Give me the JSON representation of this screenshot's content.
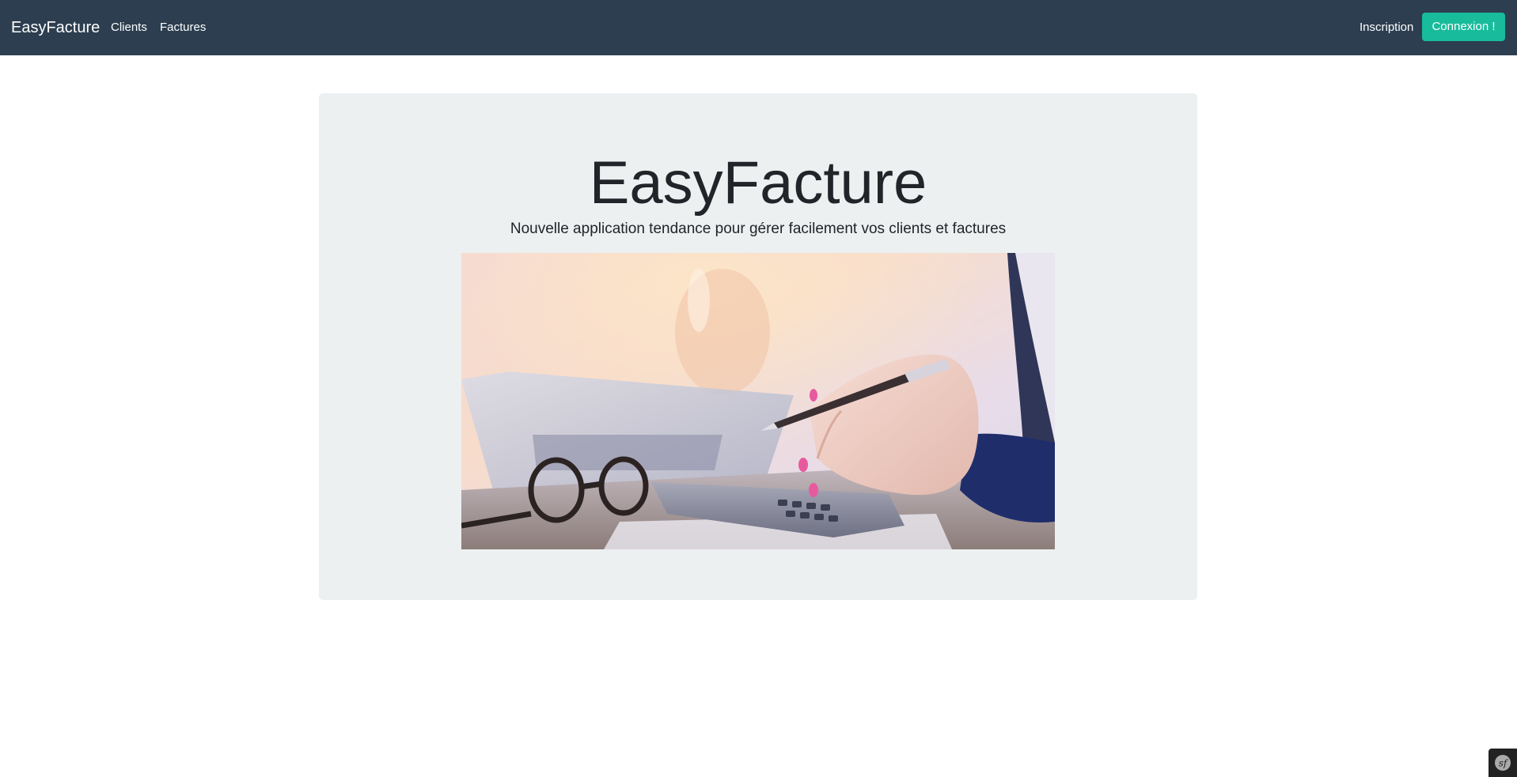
{
  "navbar": {
    "brand": "EasyFacture",
    "links": [
      {
        "label": "Clients"
      },
      {
        "label": "Factures"
      }
    ],
    "inscription_label": "Inscription",
    "connexion_label": "Connexion !",
    "background": "#2c3e50",
    "accent": "#18bc9c"
  },
  "hero": {
    "title": "EasyFacture",
    "subtitle": "Nouvelle application tendance pour gérer facilement vos clients et factures",
    "image_icon": "accounting-photo"
  },
  "toolbar": {
    "icon": "symfony-icon"
  }
}
